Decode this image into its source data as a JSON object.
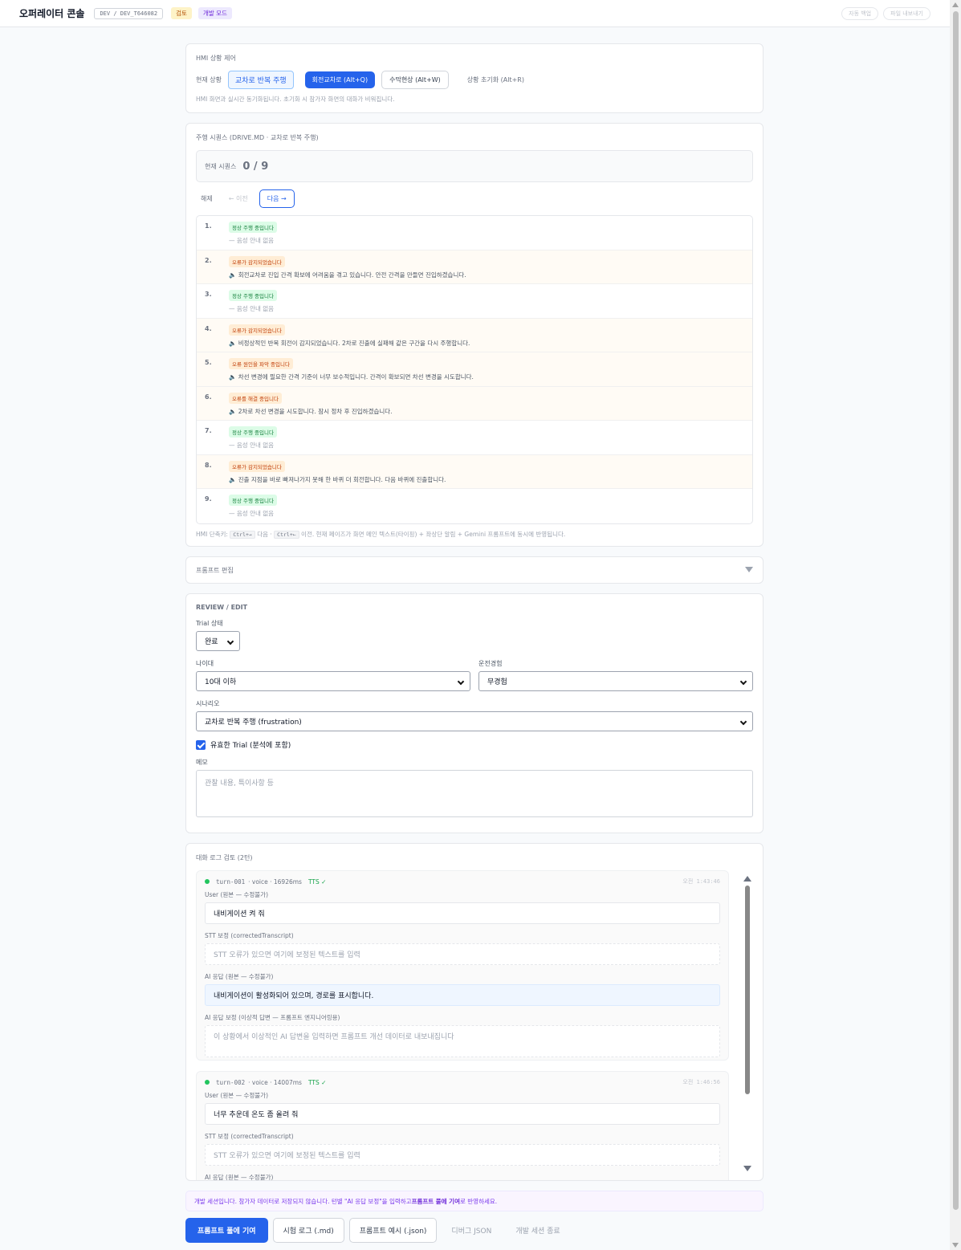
{
  "header": {
    "title": "오퍼레이터 콘솔",
    "session_id": "DEV / DEV_T646082",
    "badge_review": "검토",
    "badge_dev": "개발 모드",
    "btn_autosave": "자동 백업",
    "btn_export": "파일 내보내기"
  },
  "hmi": {
    "section_title": "HMI 상황 제어",
    "current_label": "현재 상황",
    "current_value": "교차로 반복 주행",
    "btn_roundabout": "회전교차로 (Alt+Q)",
    "btn_flood": "수막현상 (Alt+W)",
    "btn_reset": "상황 초기화 (Alt+R)",
    "hint": "HMI 화면과 실시간 동기화됩니다. 초기화 시 참가자 화면의 대화가 비워집니다."
  },
  "sequence": {
    "section_title": "주행 시퀀스 (DRIVE.MD · 교차로 반복 주행)",
    "current_label": "현재 시퀀스",
    "current_value": "0 / 9",
    "btn_release": "해제",
    "btn_prev": "← 이전",
    "btn_next": "다음 →",
    "steps": [
      {
        "num": "1.",
        "tag": "정상 주행 중입니다",
        "text": "— 음성 안내 없음"
      },
      {
        "num": "2.",
        "tag": "오류가 감지되었습니다",
        "text": "🔈 회전교차로 진입 간격 확보에 어려움을 겪고 있습니다. 안전 간격을 만들면 진입하겠습니다."
      },
      {
        "num": "3.",
        "tag": "정상 주행 중입니다",
        "text": "— 음성 안내 없음"
      },
      {
        "num": "4.",
        "tag": "오류가 감지되었습니다",
        "text": "🔈 비정상적인 반복 회전이 감지되었습니다. 2차로 진출에 실패해 같은 구간을 다시 주행합니다."
      },
      {
        "num": "5.",
        "tag": "오류 원인을 파악 중입니다",
        "text": "🔈 차선 변경에 필요한 간격 기준이 너무 보수적입니다. 간격이 확보되면 차선 변경을 시도합니다."
      },
      {
        "num": "6.",
        "tag": "오류를 해결 중입니다",
        "text": "🔈 2차로 차선 변경을 시도합니다. 잠시 정차 후 진입하겠습니다."
      },
      {
        "num": "7.",
        "tag": "정상 주행 중입니다",
        "text": "— 음성 안내 없음"
      },
      {
        "num": "8.",
        "tag": "오류가 감지되었습니다",
        "text": "🔈 진출 지점을 바로 빠져나가지 못해 한 바퀴 더 회전합니다. 다음 바퀴에 진출합니다."
      },
      {
        "num": "9.",
        "tag": "정상 주행 중입니다",
        "text": "— 음성 안내 없음"
      }
    ],
    "shortcut_prefix": "HMI 단축키:",
    "kbd_next": "Ctrl+→",
    "next_word": "다음 ·",
    "kbd_prev": "Ctrl+←",
    "shortcut_suffix": "이전. 현재 페이즈가 화면 메인 텍스트(타이핑) + 좌상단 알림 + Gemini 프롬프트에 동시에 반영됩니다."
  },
  "prompt_edit": {
    "title": "프롬프트 편집"
  },
  "review": {
    "title": "REVIEW / EDIT",
    "trial_label": "Trial 상태",
    "trial_value": "완료",
    "age_label": "나이대",
    "age_value": "10대 이하",
    "exp_label": "운전경험",
    "exp_value": "무경험",
    "scenario_label": "시나리오",
    "scenario_value": "교차로 반복 주행 (frustration)",
    "valid_label": "유효한 Trial (분석에 포함)",
    "memo_label": "메모",
    "memo_placeholder": "관찰 내용, 특이사항 등"
  },
  "log": {
    "title": "대화 로그 검토 (2턴)",
    "user_label": "User (원본 — 수정불가)",
    "stt_label": "STT 보정 (correctedTranscript)",
    "stt_placeholder": "STT 오류가 있으면 여기에 보정된 텍스트를 입력",
    "ai_label": "AI 응답 (원본 — 수정불가)",
    "ai_fix_label": "AI 응답 보정 (이상적 답변 — 프롬프트 엔지니어링용)",
    "ai_fix_placeholder": "이 상황에서 이상적인 AI 답변을 입력하면 프롬프트 개선 데이터로 내보내집니다",
    "turns": [
      {
        "id": "turn-001",
        "meta": "· voice · 16926ms",
        "tts": "TTS ✓",
        "time": "오전 1:43:46",
        "user": "내비게이션 켜 줘",
        "ai": "내비게이션이 활성화되어 있으며, 경로를 표시합니다."
      },
      {
        "id": "turn-002",
        "meta": "· voice · 14007ms",
        "tts": "TTS ✓",
        "time": "오전 1:46:56",
        "user": "너무 추운데 온도 좀 올려 줘",
        "ai": ""
      }
    ]
  },
  "notice": {
    "pre": "개발 세션입니다. 참가자 데이터로 저장되지 않습니다. 턴별 \"AI 응답 보정\"을 입력하고 ",
    "bold": "프롬프트 풀에 기여",
    "post": "로 반영하세요."
  },
  "actions": {
    "contribute": "프롬프트 풀에 기여",
    "trial_log": "시험 로그 (.md)",
    "prompt_example": "프롬프트 예시 (.json)",
    "debug_json": "디버그 JSON",
    "end_session": "개발 세션 종료"
  }
}
